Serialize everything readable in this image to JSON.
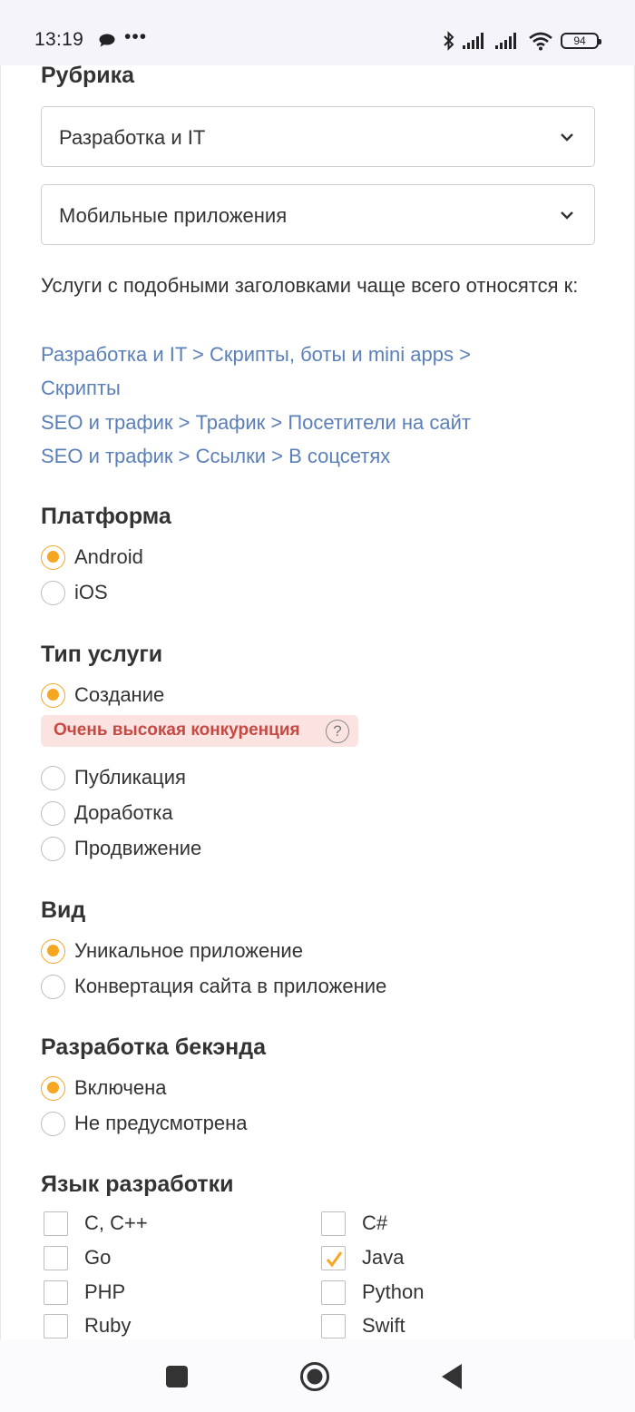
{
  "status_bar": {
    "time": "13:19",
    "dots": "•••",
    "battery": "94",
    "icons": [
      "chat-icon",
      "bluetooth-icon",
      "signal-icon",
      "signal-icon",
      "wifi-icon",
      "battery-icon"
    ]
  },
  "rubric": {
    "heading": "Рубрика",
    "category": "Разработка и IT",
    "subcategory": "Мобильные приложения"
  },
  "hint": {
    "text": "Услуги с подобными заголовками чаще всего относятся к:",
    "links": [
      "Разработка и IT > Скрипты, боты и mini apps >",
      "Скрипты",
      "SEO и трафик > Трафик > Посетители на сайт",
      "SEO и трафик > Ссылки > В соцсетях"
    ]
  },
  "platform": {
    "heading": "Платформа",
    "options": [
      "Android",
      "iOS"
    ],
    "selected": "Android"
  },
  "service_type": {
    "heading": "Тип услуги",
    "options": [
      "Создание",
      "Публикация",
      "Доработка",
      "Продвижение"
    ],
    "selected": "Создание",
    "badge": "Очень высокая конкуренция",
    "badge_help": "?"
  },
  "kind": {
    "heading": "Вид",
    "options": [
      "Уникальное приложение",
      "Конвертация сайта в приложение"
    ],
    "selected": "Уникальное приложение"
  },
  "backend": {
    "heading": "Разработка бекэнда",
    "options": [
      "Включена",
      "Не предусмотрена"
    ],
    "selected": "Включена"
  },
  "language": {
    "heading": "Язык разработки",
    "options": [
      "C, C++",
      "C#",
      "Go",
      "Java",
      "PHP",
      "Python",
      "Ruby",
      "Swift"
    ],
    "checked": [
      "Java"
    ]
  },
  "colors": {
    "accent": "#f5a623",
    "link": "#5b80b8",
    "badge_bg": "#fbe3e2",
    "badge_text": "#c54a43"
  }
}
